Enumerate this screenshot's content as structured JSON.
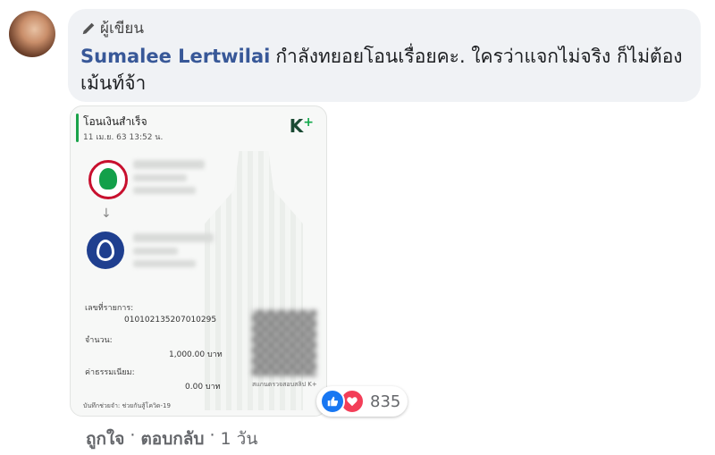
{
  "comment": {
    "badge": "ผู้เขียน",
    "author": "Sumalee Lertwilai",
    "text": "กำลังทยอยโอนเรื่อยคะ. ใครว่าแจกไม่จริง ก็ไม่ต้องเม้นท์จ้า"
  },
  "receipt": {
    "title": "โอนเงินสำเร็จ",
    "date": "11 เม.ย. 63  13:52 น.",
    "brand": "K",
    "brand_plus": "+",
    "ref_label": "เลขที่รายการ:",
    "ref_value": "010102135207010295",
    "amount_label": "จำนวน:",
    "amount_value": "1,000.00 บาท",
    "fee_label": "ค่าธรรมเนียม:",
    "fee_value": "0.00 บาท",
    "qr_caption": "สแกนตรวจสอบสลิป K+",
    "note": "บันทึกช่วยจำ: ช่วยกันสู้โควิด-19"
  },
  "reactions": {
    "count": "835",
    "types": [
      "like-icon",
      "love-icon"
    ]
  },
  "actions": {
    "like": "ถูกใจ",
    "reply": "ตอบกลับ",
    "sep": "·",
    "time": "1 วัน"
  },
  "colors": {
    "author_link": "#385898",
    "bubble": "#f0f2f5",
    "like": "#1877f2",
    "love": "#f33e58",
    "kbank_green": "#12a84a"
  }
}
